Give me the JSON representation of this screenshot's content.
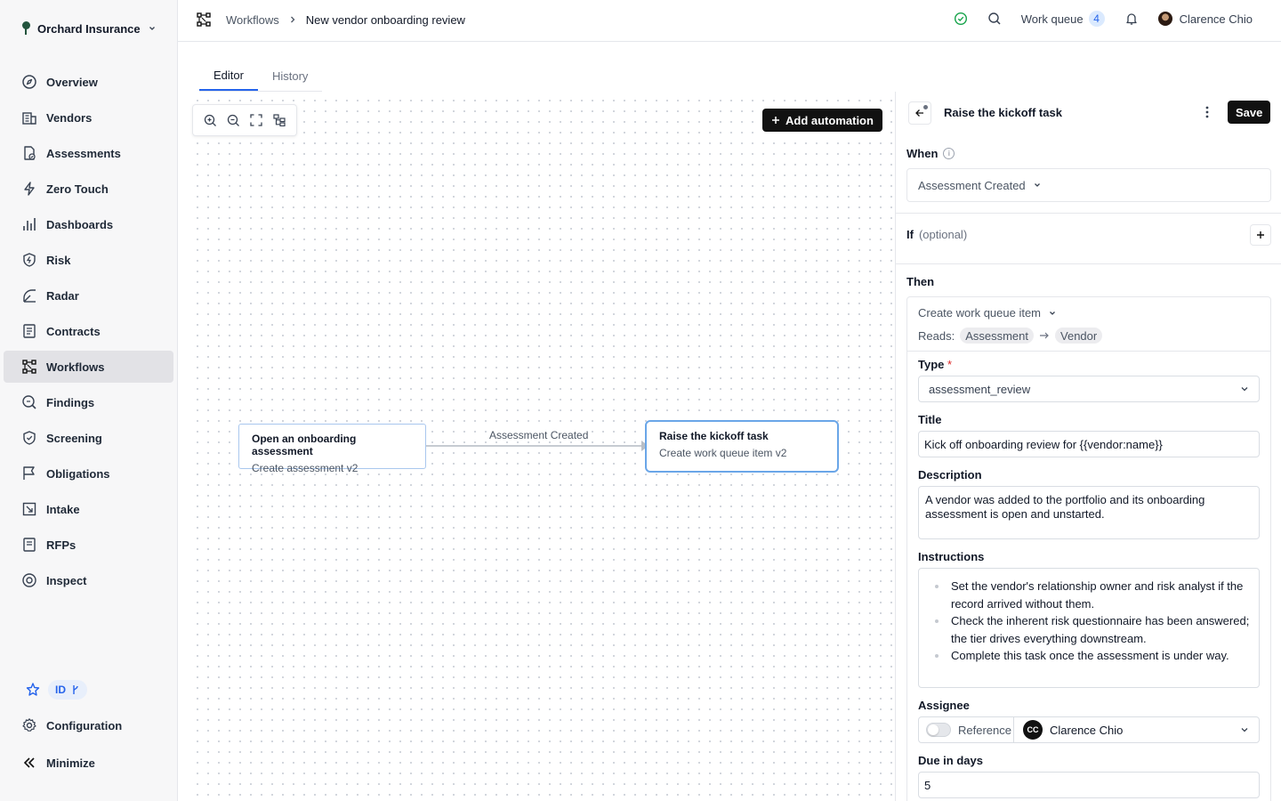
{
  "org": {
    "name": "Orchard Insurance"
  },
  "nav": [
    {
      "label": "Overview",
      "icon": "compass-icon"
    },
    {
      "label": "Vendors",
      "icon": "building-icon"
    },
    {
      "label": "Assessments",
      "icon": "document-check-icon"
    },
    {
      "label": "Zero Touch",
      "icon": "bolt-icon"
    },
    {
      "label": "Dashboards",
      "icon": "bar-chart-icon"
    },
    {
      "label": "Risk",
      "icon": "shield-bolt-icon"
    },
    {
      "label": "Radar",
      "icon": "radar-icon"
    },
    {
      "label": "Contracts",
      "icon": "contract-icon"
    },
    {
      "label": "Workflows",
      "icon": "workflow-icon",
      "active": true
    },
    {
      "label": "Findings",
      "icon": "magnifier-icon"
    },
    {
      "label": "Screening",
      "icon": "shield-check-icon"
    },
    {
      "label": "Obligations",
      "icon": "flag-icon"
    },
    {
      "label": "Intake",
      "icon": "intake-icon"
    },
    {
      "label": "RFPs",
      "icon": "rfp-icon"
    },
    {
      "label": "Inspect",
      "icon": "eye-icon"
    }
  ],
  "sidebar_bottom": {
    "id_badge": "ID",
    "configuration": "Configuration",
    "minimize": "Minimize"
  },
  "breadcrumb": {
    "parent": "Workflows",
    "current": "New vendor onboarding review"
  },
  "header": {
    "work_queue_label": "Work queue",
    "work_queue_count": "4",
    "user_name": "Clarence Chio"
  },
  "tabs": [
    {
      "label": "Editor",
      "active": true
    },
    {
      "label": "History",
      "active": false
    }
  ],
  "canvas": {
    "add_button": "Add automation",
    "nodes": [
      {
        "title": "Open an onboarding assessment",
        "subtitle": "Create assessment v2"
      },
      {
        "title": "Raise the kickoff task",
        "subtitle": "Create work queue item v2",
        "selected": true
      }
    ],
    "edge_label": "Assessment Created"
  },
  "panel": {
    "title": "Raise the kickoff task",
    "save": "Save",
    "when_label": "When",
    "when_value": "Assessment Created",
    "if_label": "If",
    "if_optional": "(optional)",
    "then_label": "Then",
    "action": "Create work queue item",
    "reads_label": "Reads:",
    "reads": [
      "Assessment",
      "Vendor"
    ],
    "type_label": "Type",
    "type_required": "*",
    "type_value": "assessment_review",
    "title_label": "Title",
    "title_value": "Kick off onboarding review for {{vendor:name}}",
    "description_label": "Description",
    "description_value": "A vendor was added to the portfolio and its onboarding assessment is open and unstarted.",
    "instructions_label": "Instructions",
    "instructions": [
      "Set the vendor's relationship owner and risk analyst if the record arrived without them.",
      "Check the inherent risk questionnaire has been answered; the tier drives everything downstream.",
      "Complete this task once the assessment is under way."
    ],
    "assignee_label": "Assignee",
    "reference_label": "Reference",
    "assignee_initials": "CC",
    "assignee_name": "Clarence Chio",
    "due_label": "Due in days",
    "due_value": "5"
  },
  "colors": {
    "accent": "#2563eb",
    "status_ok": "#16a34a",
    "node_border": "#a9c7ee"
  }
}
